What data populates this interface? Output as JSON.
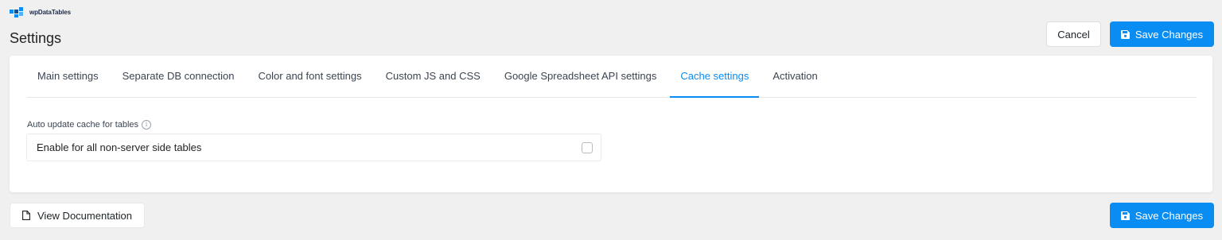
{
  "brand": {
    "name": "wpDataTables"
  },
  "page": {
    "title": "Settings"
  },
  "actions": {
    "cancel_label": "Cancel",
    "save_label": "Save Changes",
    "view_docs_label": "View Documentation"
  },
  "tabs": [
    {
      "label": "Main settings",
      "active": false
    },
    {
      "label": "Separate DB connection",
      "active": false
    },
    {
      "label": "Color and font settings",
      "active": false
    },
    {
      "label": "Custom JS and CSS",
      "active": false
    },
    {
      "label": "Google Spreadsheet API settings",
      "active": false
    },
    {
      "label": "Cache settings",
      "active": true
    },
    {
      "label": "Activation",
      "active": false
    }
  ],
  "cache_settings": {
    "auto_update_label": "Auto update cache for tables",
    "info_glyph": "i",
    "enable_all_label": "Enable for all non-server side tables",
    "enable_all_checked": false
  },
  "colors": {
    "accent": "#0a8df2",
    "background": "#f0f0f1"
  },
  "icons": {
    "brand": "wpdatatables-logo-icon",
    "save": "floppy-disk-icon",
    "doc": "document-icon",
    "info": "info-icon"
  }
}
